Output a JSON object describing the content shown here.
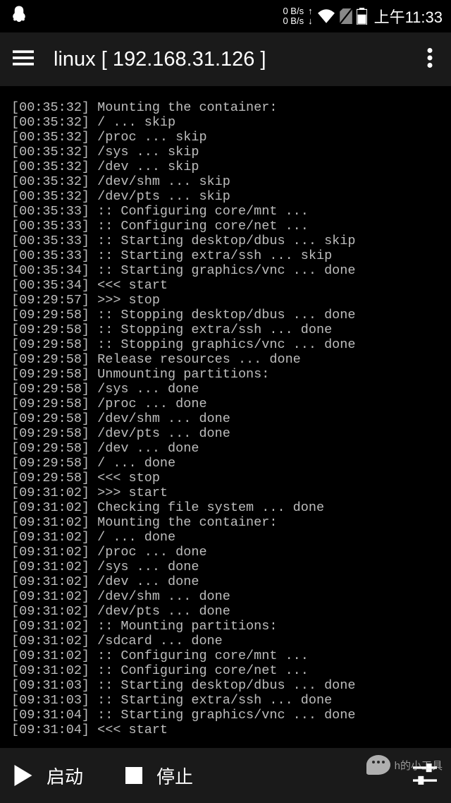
{
  "status": {
    "net_down": "0 B/s",
    "net_up": "0 B/s",
    "time": "上午11:33"
  },
  "header": {
    "title": "linux  [ 192.168.31.126 ]"
  },
  "terminal": {
    "lines": [
      "[00:35:32] Mounting the container:",
      "[00:35:32] / ... skip",
      "[00:35:32] /proc ... skip",
      "[00:35:32] /sys ... skip",
      "[00:35:32] /dev ... skip",
      "[00:35:32] /dev/shm ... skip",
      "[00:35:32] /dev/pts ... skip",
      "[00:35:33] :: Configuring core/mnt ...",
      "[00:35:33] :: Configuring core/net ...",
      "[00:35:33] :: Starting desktop/dbus ... skip",
      "[00:35:33] :: Starting extra/ssh ... skip",
      "[00:35:34] :: Starting graphics/vnc ... done",
      "[00:35:34] <<< start",
      "[09:29:57] >>> stop",
      "[09:29:58] :: Stopping desktop/dbus ... done",
      "[09:29:58] :: Stopping extra/ssh ... done",
      "[09:29:58] :: Stopping graphics/vnc ... done",
      "[09:29:58] Release resources ... done",
      "[09:29:58] Unmounting partitions:",
      "[09:29:58] /sys ... done",
      "[09:29:58] /proc ... done",
      "[09:29:58] /dev/shm ... done",
      "[09:29:58] /dev/pts ... done",
      "[09:29:58] /dev ... done",
      "[09:29:58] / ... done",
      "[09:29:58] <<< stop",
      "[09:31:02] >>> start",
      "[09:31:02] Checking file system ... done",
      "[09:31:02] Mounting the container:",
      "[09:31:02] / ... done",
      "[09:31:02] /proc ... done",
      "[09:31:02] /sys ... done",
      "[09:31:02] /dev ... done",
      "[09:31:02] /dev/shm ... done",
      "[09:31:02] /dev/pts ... done",
      "[09:31:02] :: Mounting partitions:",
      "[09:31:02] /sdcard ... done",
      "[09:31:02] :: Configuring core/mnt ...",
      "[09:31:02] :: Configuring core/net ...",
      "[09:31:03] :: Starting desktop/dbus ... done",
      "[09:31:03] :: Starting extra/ssh ... done",
      "[09:31:04] :: Starting graphics/vnc ... done",
      "[09:31:04] <<< start"
    ]
  },
  "bottom": {
    "start_label": "启动",
    "stop_label": "停止"
  },
  "watermark": {
    "text": "h的小工具"
  }
}
